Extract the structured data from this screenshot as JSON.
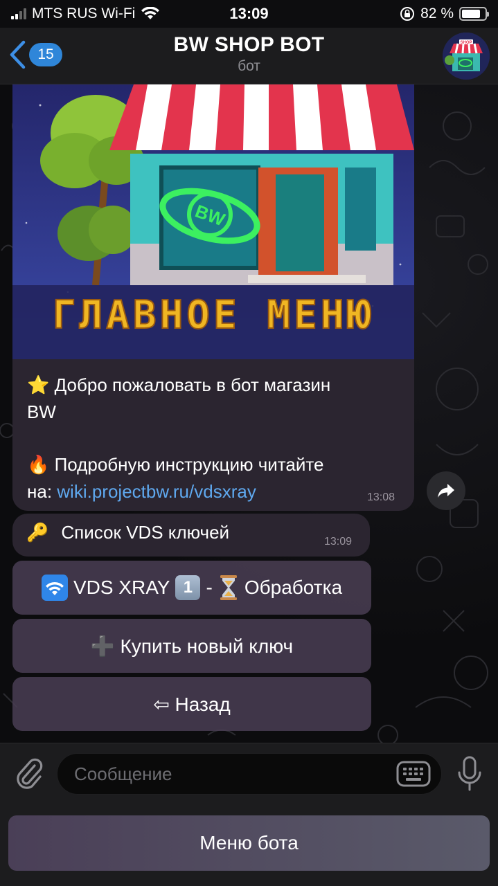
{
  "status_bar": {
    "carrier": "MTS RUS Wi-Fi",
    "time": "13:09",
    "battery": "82 %",
    "battery_level": 0.82
  },
  "header": {
    "back_count": "15",
    "title": "BW SHOP BOT",
    "subtitle": "бот"
  },
  "banner": {
    "store_sign": "SHOP",
    "logo_text": "BW",
    "caption": "ГЛАВНОЕ МЕНЮ"
  },
  "message": {
    "emoji_star": "⭐",
    "welcome_line1": "Добро пожаловать в бот магазин",
    "welcome_line2": "BW",
    "emoji_fire": "🔥",
    "instruction_line1": "Подробную инструкцию читайте",
    "instruction_prefix": "на:",
    "link": "wiki.projectbw.ru/vdsxray",
    "time": "13:08"
  },
  "keys_message": {
    "emoji_key": "🔑",
    "text": "Список VDS ключей",
    "time": "13:09"
  },
  "keyboard": {
    "btn_vds": "VDS XRAY",
    "btn_vds_num": "1",
    "btn_vds_sep": "-",
    "btn_vds_status": "Обработка",
    "btn_buy": "➕ Купить новый ключ",
    "btn_back": "⇦ Назад"
  },
  "input": {
    "placeholder": "Сообщение"
  },
  "menu_button": "Меню бота"
}
